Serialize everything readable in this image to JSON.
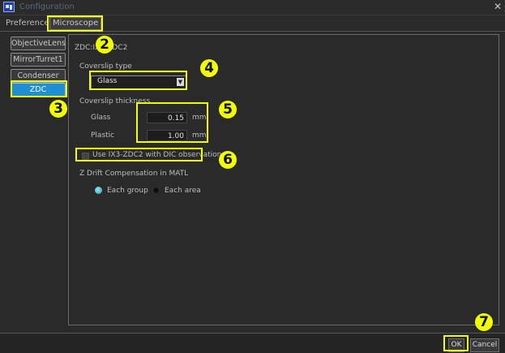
{
  "window": {
    "title": "Configuration"
  },
  "tabs": [
    {
      "label": "Preference"
    },
    {
      "label": "Microscope"
    }
  ],
  "sidebar": {
    "items": [
      {
        "label": "ObjectiveLens"
      },
      {
        "label": "MirrorTurret1"
      },
      {
        "label": "Condenser"
      },
      {
        "label": "ZDC"
      }
    ]
  },
  "panel": {
    "heading": "ZDC:IX3-ZDC2",
    "coverslip_type_label": "Coverslip type",
    "coverslip_type_value": "Glass",
    "coverslip_thickness_label": "Coverslip thickness",
    "glass_label": "Glass",
    "glass_value": "0.15",
    "plastic_label": "Plastic",
    "plastic_value": "1.00",
    "unit": "mm",
    "dic_checkbox_label": "Use IX3-ZDC2 with DIC observation",
    "dic_checked": false,
    "zdrift_label": "Z Drift Compensation in MATL",
    "radio_each_group": "Each group",
    "radio_each_area": "Each area",
    "selected_radio": "Each group"
  },
  "buttons": {
    "ok": "OK",
    "cancel": "Cancel"
  },
  "callouts": [
    "2",
    "3",
    "4",
    "5",
    "6",
    "7"
  ],
  "colors": {
    "highlight": "#f2ff00",
    "selected": "#1f8fd2",
    "background": "#2a2a2a"
  }
}
